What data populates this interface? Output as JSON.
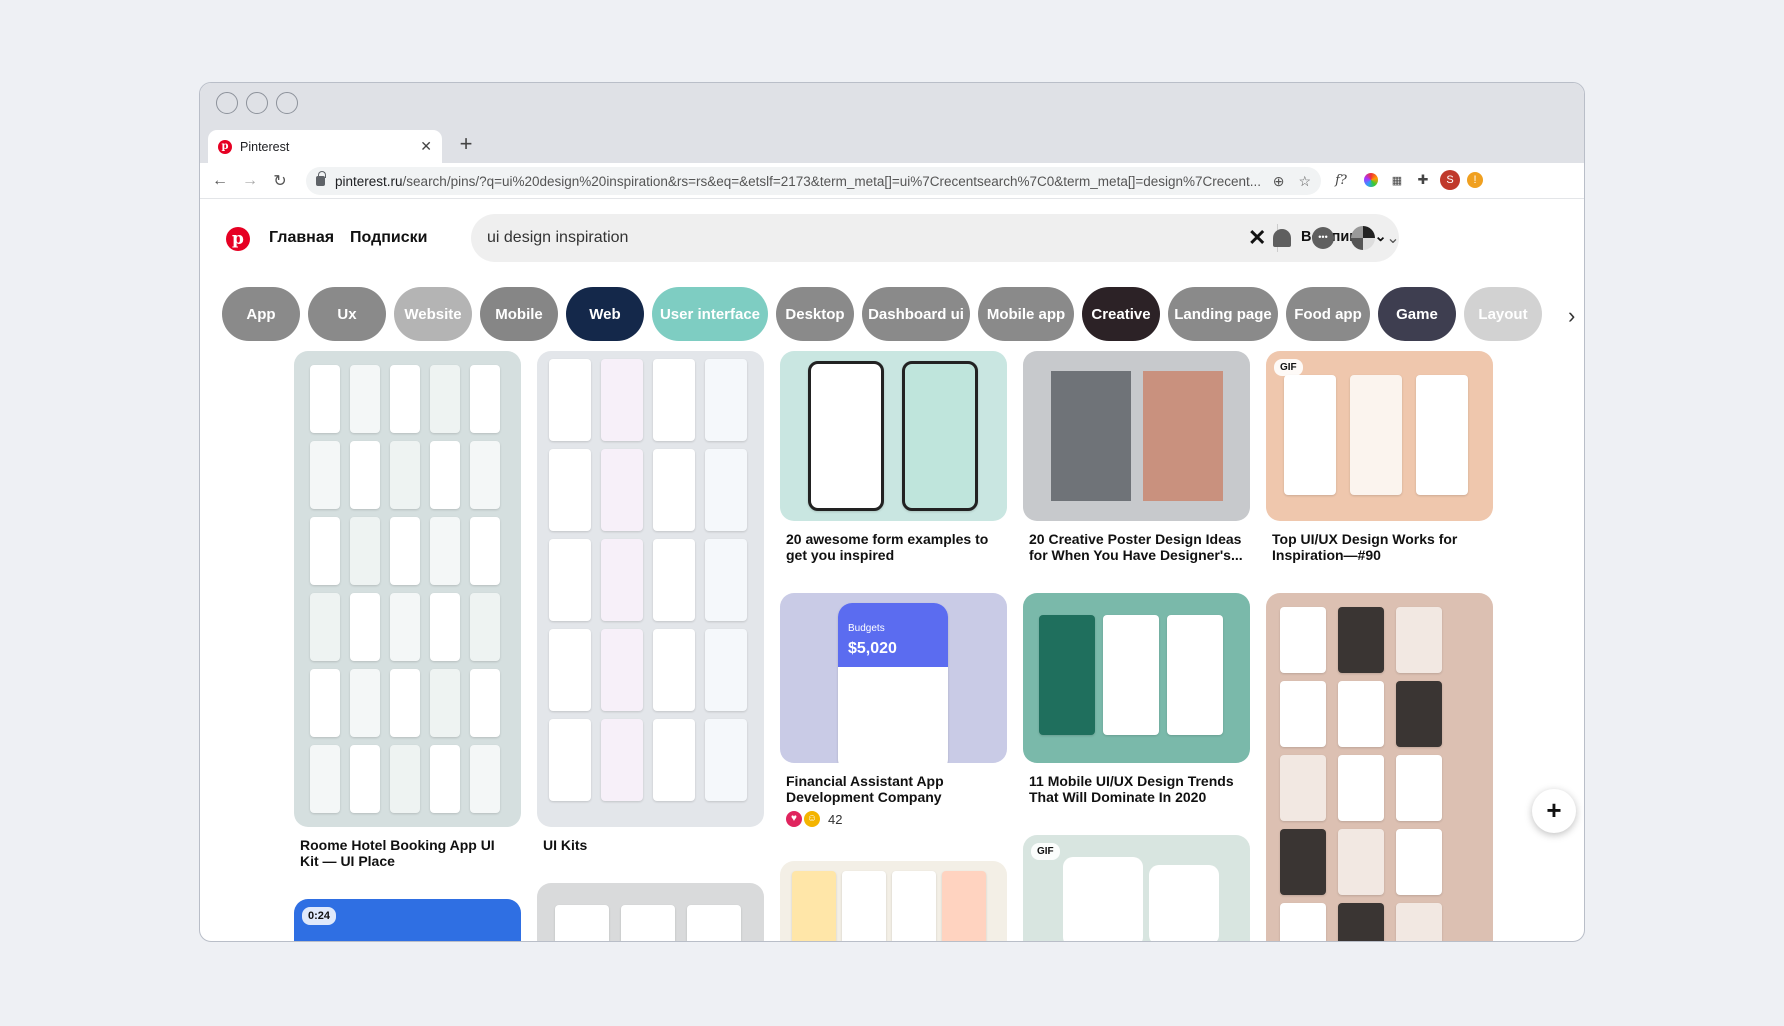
{
  "browser": {
    "tab_title": "Pinterest",
    "new_tab": "+",
    "url_host": "pinterest.ru",
    "url_path": "/search/pins/?q=ui%20design%20inspiration&rs=rs&eq=&etslf=2173&term_meta[]=ui%7Crecentsearch%7C0&term_meta[]=design%7Crecent...",
    "ext_fx": "f?",
    "ext_avatar": "S"
  },
  "header": {
    "home": "Главная",
    "following": "Подписки",
    "search_value": "ui design inspiration",
    "filter": "Все пины",
    "chat_dots": "•••"
  },
  "chips": [
    {
      "label": "App",
      "color": "#8a8a8a",
      "w": 78
    },
    {
      "label": "Ux",
      "color": "#8a8a8a",
      "w": 78
    },
    {
      "label": "Website",
      "color": "#b4b4b4",
      "w": 78
    },
    {
      "label": "Mobile",
      "color": "#868686",
      "w": 78
    },
    {
      "label": "Web",
      "color": "#14284a",
      "w": 78
    },
    {
      "label": "User interface",
      "color": "#7ecdc2",
      "w": 116
    },
    {
      "label": "Desktop",
      "color": "#8a8a8a",
      "w": 78
    },
    {
      "label": "Dashboard ui",
      "color": "#8a8a8a",
      "w": 108
    },
    {
      "label": "Mobile app",
      "color": "#8a8a8a",
      "w": 96
    },
    {
      "label": "Creative",
      "color": "#2c2226",
      "w": 78
    },
    {
      "label": "Landing page",
      "color": "#8a8a8a",
      "w": 110
    },
    {
      "label": "Food app",
      "color": "#8a8a8a",
      "w": 84
    },
    {
      "label": "Game",
      "color": "#3e3e50",
      "w": 78
    },
    {
      "label": "Layout",
      "color": "#d2d2d2",
      "w": 78
    }
  ],
  "pins": {
    "p1": {
      "title": "Roome Hotel Booking App UI Kit — UI Place",
      "bg": "#d5dfdf"
    },
    "p2": {
      "title": "UI Kits",
      "bg": "#e3e6ea"
    },
    "p3": {
      "title": "20 awesome form examples to get you inspired",
      "bg": "#c9e6e1"
    },
    "p4": {
      "title": "20 Creative Poster Design Ideas for When You Have Designer's...",
      "bg": "#c7c9cc"
    },
    "p5": {
      "title": "Top UI/UX Design Works for Inspiration—#90",
      "badge": "GIF",
      "bg": "#efc7ad"
    },
    "p6": {
      "title": "Financial Assistant App Development Company",
      "bg": "#c9cbe6",
      "reactions": "42",
      "budget_label": "Budgets",
      "budget_value": "$5,020"
    },
    "p7": {
      "title": "11 Mobile UI/UX Design Trends That Will Dominate In 2020",
      "bg": "#7ab9aa"
    },
    "p8": {
      "bg": "#dcc0b2"
    },
    "p9": {
      "badge": "0:24",
      "bg": "#2f6fe3"
    },
    "p10": {
      "bg": "#d9dadb"
    },
    "p11": {
      "bg": "#f3efe6"
    },
    "p12": {
      "badge": "GIF",
      "bg": "#d8e5e0"
    }
  }
}
